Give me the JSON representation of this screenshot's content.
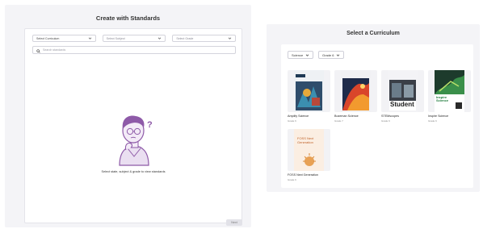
{
  "left_panel": {
    "title": "Create with Standards",
    "filters": [
      {
        "label": "Select Curriculum"
      },
      {
        "label": "Select Subject"
      },
      {
        "label": "Select Grade"
      }
    ],
    "search_placeholder": "Search standards",
    "empty_message": "Select state, subject & grade to view standards",
    "next_label": "Next"
  },
  "right_panel": {
    "title": "Select a Curriculum",
    "filters": [
      {
        "label": "Science"
      },
      {
        "label": "Grade 6"
      }
    ],
    "curricula": [
      {
        "title": "Amplify Science",
        "grade": "Grade 6",
        "cover_label": "Grade 6"
      },
      {
        "title": "Bozeman Science",
        "grade": "Grade 7",
        "cover_label": ""
      },
      {
        "title": "STEMscopes",
        "grade": "Grade 6",
        "cover_label": "Student"
      },
      {
        "title": "Inspire Science",
        "grade": "Grade 6",
        "cover_label": "Inspire Science"
      },
      {
        "title": "FOSS Next Generation",
        "grade": "Grade 6",
        "cover_label": "FOSS Next Generation"
      }
    ]
  },
  "colors": {
    "frame_bg": "#f4f4f7",
    "illustration_purple": "#8e5aa8"
  }
}
